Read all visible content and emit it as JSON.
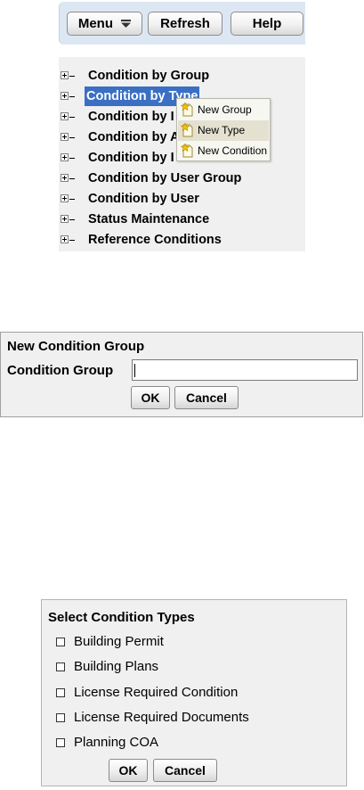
{
  "toolbar": {
    "menu_label": "Menu",
    "refresh_label": "Refresh",
    "help_label": "Help"
  },
  "tree": {
    "items": [
      {
        "label": "Condition by Group"
      },
      {
        "label": "Condition by Type",
        "selected": true
      },
      {
        "label": "Condition by I"
      },
      {
        "label": "Condition by A"
      },
      {
        "label": "Condition by I"
      },
      {
        "label": "Condition by User Group"
      },
      {
        "label": "Condition by User"
      },
      {
        "label": "Status Maintenance"
      },
      {
        "label": "Reference Conditions"
      }
    ],
    "selected_color": "#3a6fc4"
  },
  "context_menu": {
    "items": [
      {
        "label": "New Group",
        "icon": "new-item-icon"
      },
      {
        "label": "New Type",
        "icon": "new-item-icon",
        "hovered": true
      },
      {
        "label": "New Condition",
        "icon": "new-item-icon"
      }
    ]
  },
  "new_group_dialog": {
    "title": "New Condition Group",
    "field_label": "Condition Group",
    "field_value": "",
    "ok_label": "OK",
    "cancel_label": "Cancel"
  },
  "select_types_dialog": {
    "title": "Select Condition Types",
    "options": [
      {
        "label": "Building Permit",
        "checked": false
      },
      {
        "label": "Building Plans",
        "checked": false
      },
      {
        "label": "License Required Condition",
        "checked": false
      },
      {
        "label": "License Required Documents",
        "checked": false
      },
      {
        "label": "Planning COA",
        "checked": false
      }
    ],
    "ok_label": "OK",
    "cancel_label": "Cancel"
  }
}
